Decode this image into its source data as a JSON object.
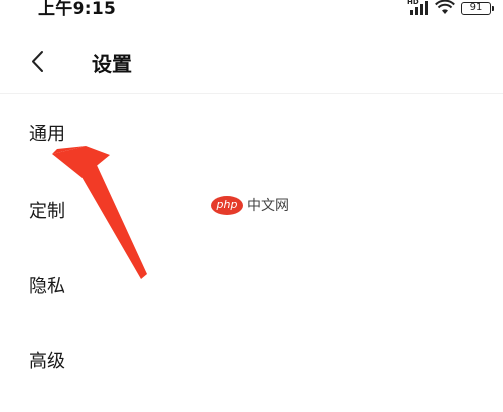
{
  "status_bar": {
    "time": "上午9:15",
    "network_label": "HD",
    "battery_level": "91",
    "icons": [
      "signal-icon",
      "wifi-icon",
      "battery-icon"
    ]
  },
  "header": {
    "back_icon": "chevron-left-icon",
    "title": "设置"
  },
  "menu": {
    "items": [
      {
        "label": "通用"
      },
      {
        "label": "定制"
      },
      {
        "label": "隐私"
      },
      {
        "label": "高级"
      }
    ]
  },
  "watermark": {
    "badge": "php",
    "text": "中文网"
  },
  "annotation": {
    "color": "#f23b26"
  }
}
